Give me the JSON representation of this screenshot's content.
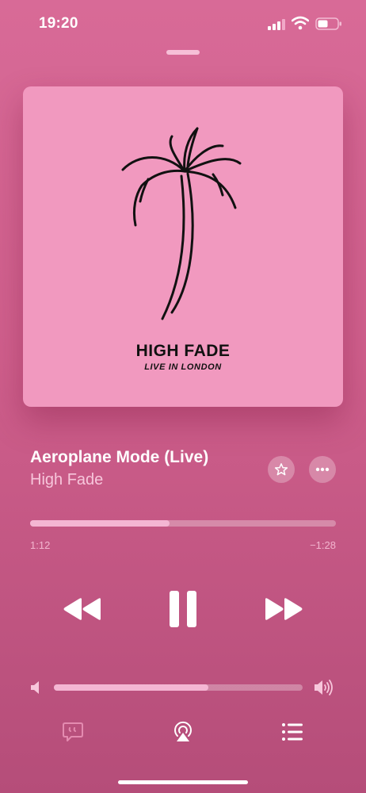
{
  "status_bar": {
    "time": "19:20"
  },
  "artwork": {
    "title": "HIGH FADE",
    "subtitle": "LIVE IN LONDON"
  },
  "now_playing": {
    "title": "Aeroplane Mode (Live)",
    "artist": "High Fade"
  },
  "progress": {
    "elapsed": "1:12",
    "remaining": "−1:28",
    "fraction": 0.455
  },
  "volume": {
    "fraction": 0.62
  },
  "icons": {
    "status": [
      "signal-icon",
      "wifi-icon",
      "battery-icon"
    ],
    "controls": [
      "rewind-icon",
      "pause-icon",
      "fast-forward-icon"
    ],
    "actions": [
      "star-icon",
      "more-icon"
    ],
    "bottom": [
      "lyrics-icon",
      "airplay-icon",
      "queue-icon"
    ]
  },
  "colors": {
    "background": "#cf5f8c",
    "artwork_background": "#f199bf",
    "progress_fill": "#f4b6d3",
    "secondary_text": "#f7c6db"
  }
}
